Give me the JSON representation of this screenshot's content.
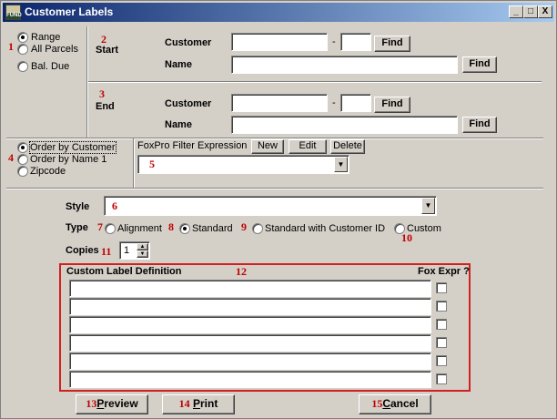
{
  "window": {
    "title": "Customer Labels",
    "icon_text": "FUND",
    "minimize": "_",
    "maximize": "□",
    "close": "X"
  },
  "markers": [
    "1",
    "2",
    "3",
    "4",
    "5",
    "6",
    "7",
    "8",
    "9",
    "10",
    "11",
    "12",
    "13",
    "14",
    "15"
  ],
  "selection": {
    "options": [
      {
        "label": "Range",
        "selected": true
      },
      {
        "label": "All Parcels",
        "selected": false
      },
      {
        "label": "Bal. Due",
        "selected": false
      }
    ]
  },
  "start": {
    "heading": "Start",
    "customer_label": "Customer",
    "dash": "-",
    "find_label": "Find",
    "name_label": "Name"
  },
  "end": {
    "heading": "End",
    "customer_label": "Customer",
    "dash": "-",
    "find_label": "Find",
    "name_label": "Name"
  },
  "order": {
    "options": [
      {
        "label": "Order by Customer",
        "selected": true
      },
      {
        "label": "Order by Name 1",
        "selected": false
      },
      {
        "label": "Zipcode",
        "selected": false
      }
    ]
  },
  "filter": {
    "label": "FoxPro Filter Expression",
    "new_label": "New",
    "edit_label": "Edit",
    "delete_label": "Delete",
    "value": ""
  },
  "style": {
    "label": "Style",
    "value": ""
  },
  "type": {
    "label": "Type",
    "options": [
      {
        "label": "Alignment",
        "selected": false
      },
      {
        "label": "Standard",
        "selected": true
      },
      {
        "label": "Standard with Customer ID",
        "selected": false
      },
      {
        "label": "Custom",
        "selected": false
      }
    ]
  },
  "copies": {
    "label": "Copies",
    "value": "1"
  },
  "custom": {
    "header": "Custom Label Definition",
    "fox_header": "Fox Expr ?",
    "rows": [
      "",
      "",
      "",
      "",
      "",
      ""
    ]
  },
  "actions": {
    "preview": "Preview",
    "preview_key": "P",
    "print": "Print",
    "print_key": "P",
    "cancel": "Cancel",
    "cancel_key": "C"
  },
  "colors": {
    "title_start": "#0a246a",
    "title_end": "#a6caf0",
    "marker": "#c00000",
    "custom_border": "#d02020",
    "face": "#d4d0c8"
  }
}
